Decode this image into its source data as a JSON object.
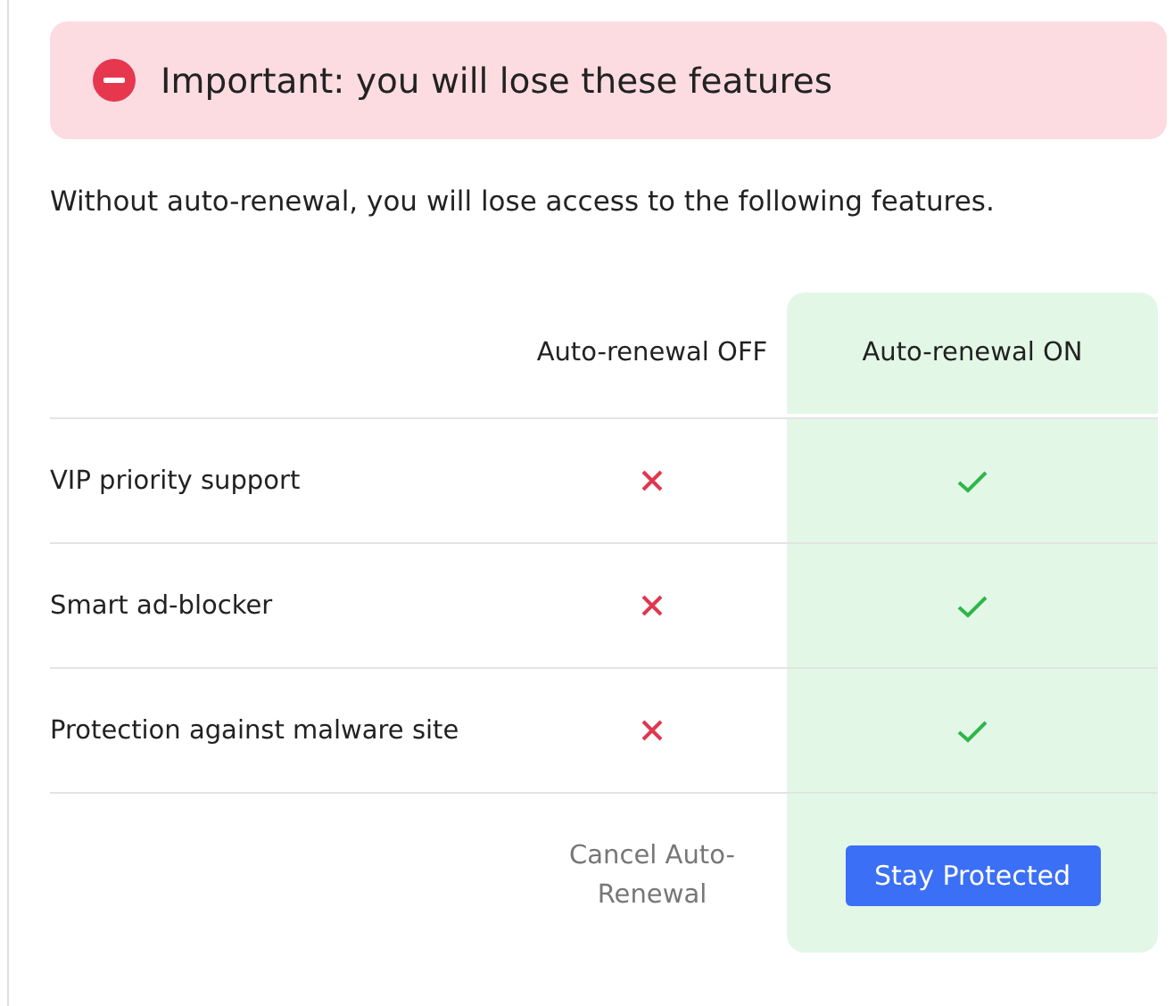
{
  "alert": {
    "title": "Important: you will lose these features"
  },
  "intro": "Without auto-renewal, you will lose access to the following features.",
  "columns": [
    "Auto-renewal OFF",
    "Auto-renewal ON"
  ],
  "features": [
    {
      "name": "VIP priority support",
      "off_included": false,
      "on_included": true
    },
    {
      "name": "Smart ad-blocker",
      "off_included": false,
      "on_included": true
    },
    {
      "name": "Protection against malware site",
      "off_included": false,
      "on_included": true
    }
  ],
  "cancel_link": "Cancel Auto-Renewal",
  "stay_button": "Stay Protected"
}
